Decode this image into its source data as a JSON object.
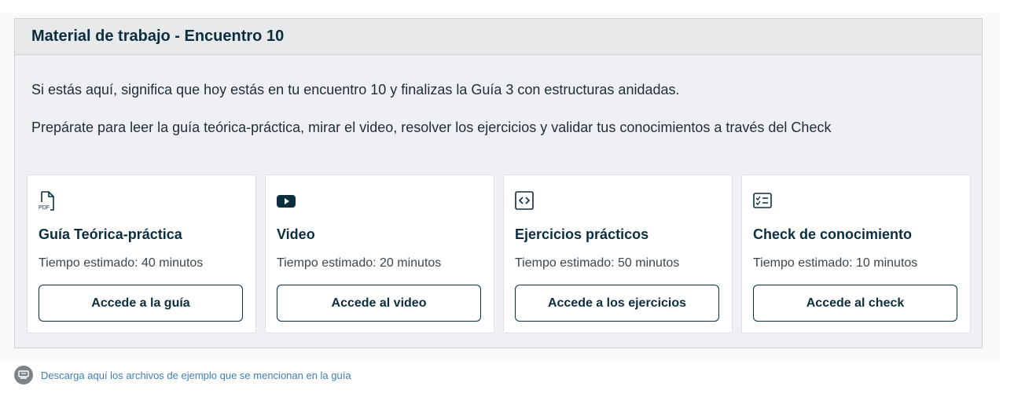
{
  "panel": {
    "title": "Material de trabajo - Encuentro 10",
    "intro_1": "Si estás aquí, significa que hoy estás en tu encuentro 10 y finalizas la Guía 3 con estructuras anidadas.",
    "intro_2": "Prepárate para leer la guía teórica-práctica, mirar el video, resolver los ejercicios y validar tus conocimientos a través del Check"
  },
  "cards": [
    {
      "icon": "pdf-file-icon",
      "icon_text": "PDF",
      "title": "Guía Teórica-práctica",
      "time": "Tiempo estimado: 40 minutos",
      "button": "Accede a la guía"
    },
    {
      "icon": "video-play-icon",
      "title": "Video",
      "time": "Tiempo estimado: 20 minutos",
      "button": "Accede al video"
    },
    {
      "icon": "code-icon",
      "title": "Ejercicios prácticos",
      "time": "Tiempo estimado: 50 minutos",
      "button": "Accede a los ejercicios"
    },
    {
      "icon": "checklist-icon",
      "title": "Check de conocimiento",
      "time": "Tiempo estimado: 10 minutos",
      "button": "Accede al check"
    }
  ],
  "download": {
    "icon": "download-icon",
    "label": "Descarga aquí los archivos de ejemplo que se mencionan en la guía"
  }
}
